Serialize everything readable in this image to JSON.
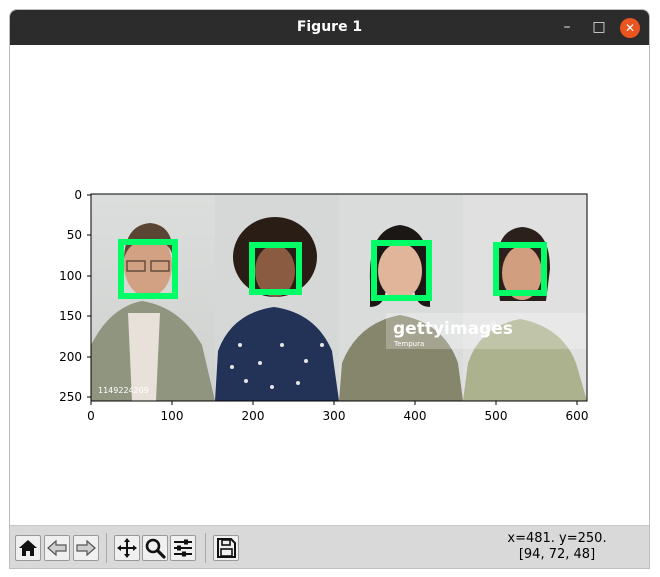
{
  "window": {
    "title": "Figure 1",
    "controls": {
      "minimize": "–",
      "maximize": "□",
      "close": "✕"
    }
  },
  "plot": {
    "x_ticks": [
      "0",
      "100",
      "200",
      "300",
      "400",
      "500",
      "600"
    ],
    "y_ticks": [
      "0",
      "50",
      "100",
      "150",
      "200",
      "250"
    ],
    "image": {
      "id_text": "1149224209",
      "watermark": "gettyimages",
      "watermark_credit": "Tempura",
      "registered": "®"
    },
    "box_color": "#00ff66"
  },
  "toolbar": {
    "buttons": [
      "home-icon",
      "back-icon",
      "forward-icon",
      "pan-icon",
      "zoom-icon",
      "configure-subplots-icon",
      "save-icon"
    ]
  },
  "status": {
    "coords": "x=481. y=250.",
    "pixel": "[94, 72, 48]"
  }
}
